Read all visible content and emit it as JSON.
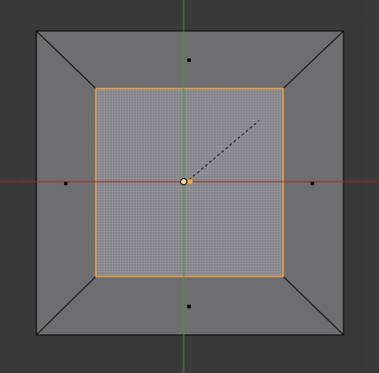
{
  "viewport": {
    "view": "top-orthographic",
    "mode": "edit-mode-face-select",
    "colors": {
      "background": "#393939",
      "grid_line": "#353535",
      "mesh_face": "#6e6e70",
      "mesh_edge": "#000000",
      "selected_face": "#8d8d92",
      "selected_edge": "#f2a23a",
      "x_axis": "#9c2a2a",
      "y_axis": "#3f9a3f",
      "face_dot": "#000000",
      "cursor_dot": "#f2a23a"
    },
    "icons": {
      "pivot": "pivot-point-icon",
      "scale_guide": "scale-dashed-line-icon"
    }
  }
}
